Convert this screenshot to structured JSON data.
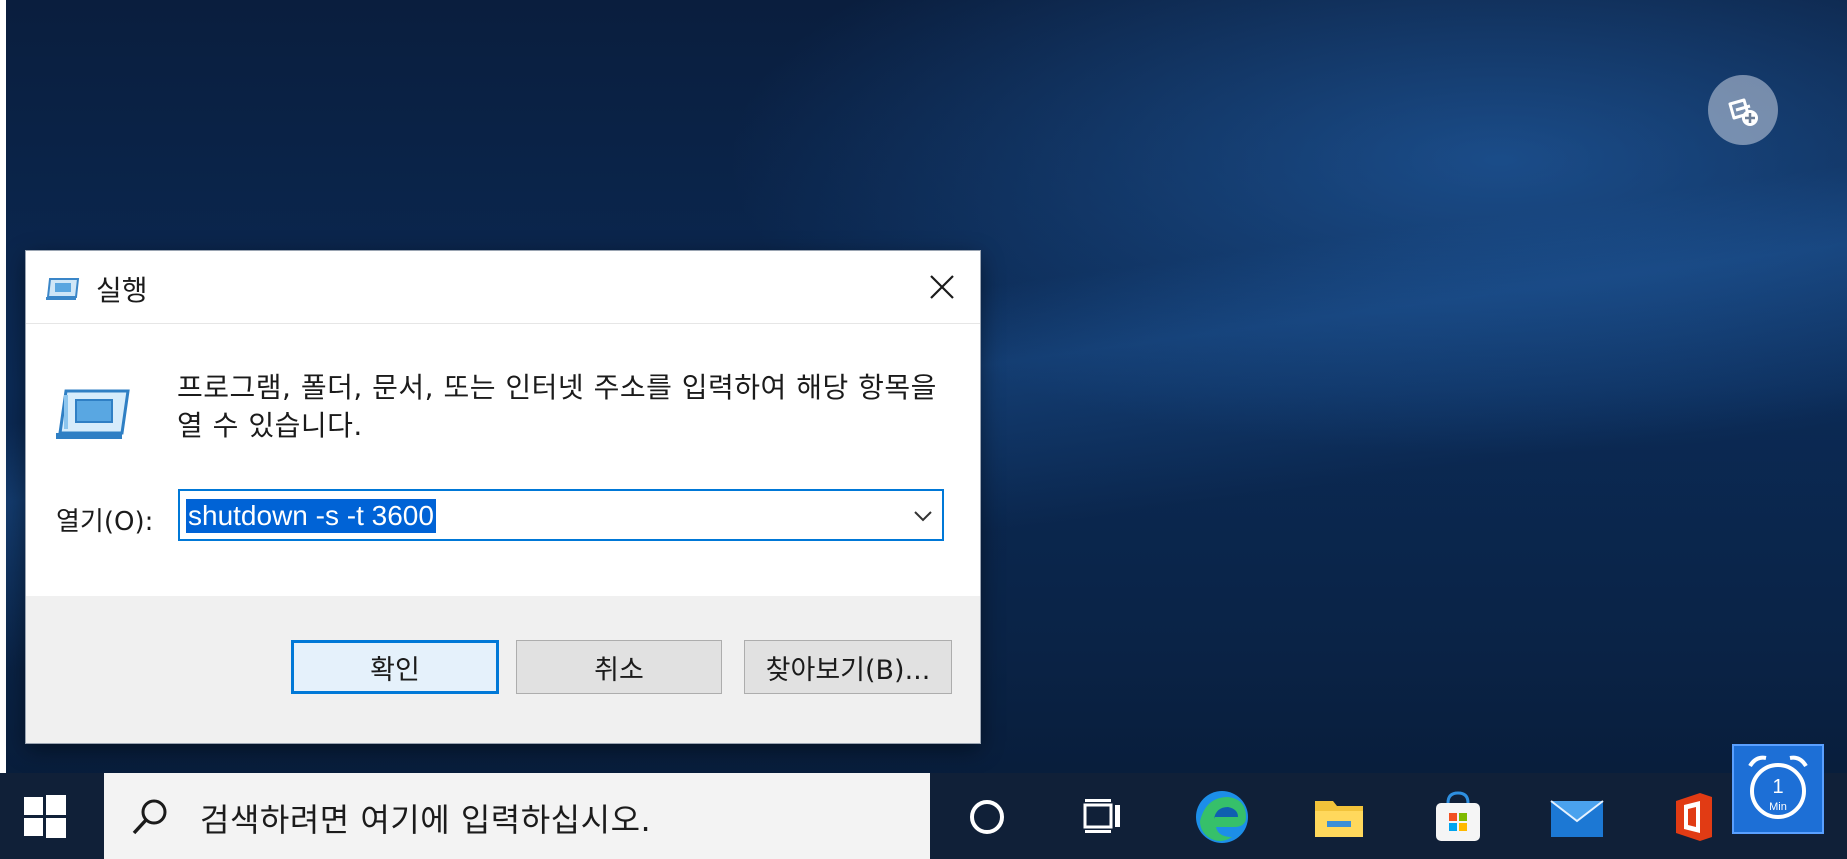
{
  "dialog": {
    "title": "실행",
    "description": "프로그램, 폴더, 문서, 또는 인터넷 주소를 입력하여 해당 항목을 열 수 있습니다.",
    "open_label": "열기(O):",
    "open_value": "shutdown -s -t 3600",
    "ok_label": "확인",
    "cancel_label": "취소",
    "browse_label": "찾아보기(B)..."
  },
  "taskbar": {
    "search_placeholder": "검색하려면 여기에 입력하십시오.",
    "icons": [
      "windows-start-icon",
      "cortana-icon",
      "task-view-icon",
      "edge-icon",
      "file-explorer-icon",
      "store-icon",
      "mail-icon",
      "office-icon"
    ]
  },
  "timer_widget": {
    "number": "1",
    "unit": "Min"
  },
  "colors": {
    "accent": "#0078d7",
    "selection": "#0063d6",
    "taskbar": "#102038"
  }
}
